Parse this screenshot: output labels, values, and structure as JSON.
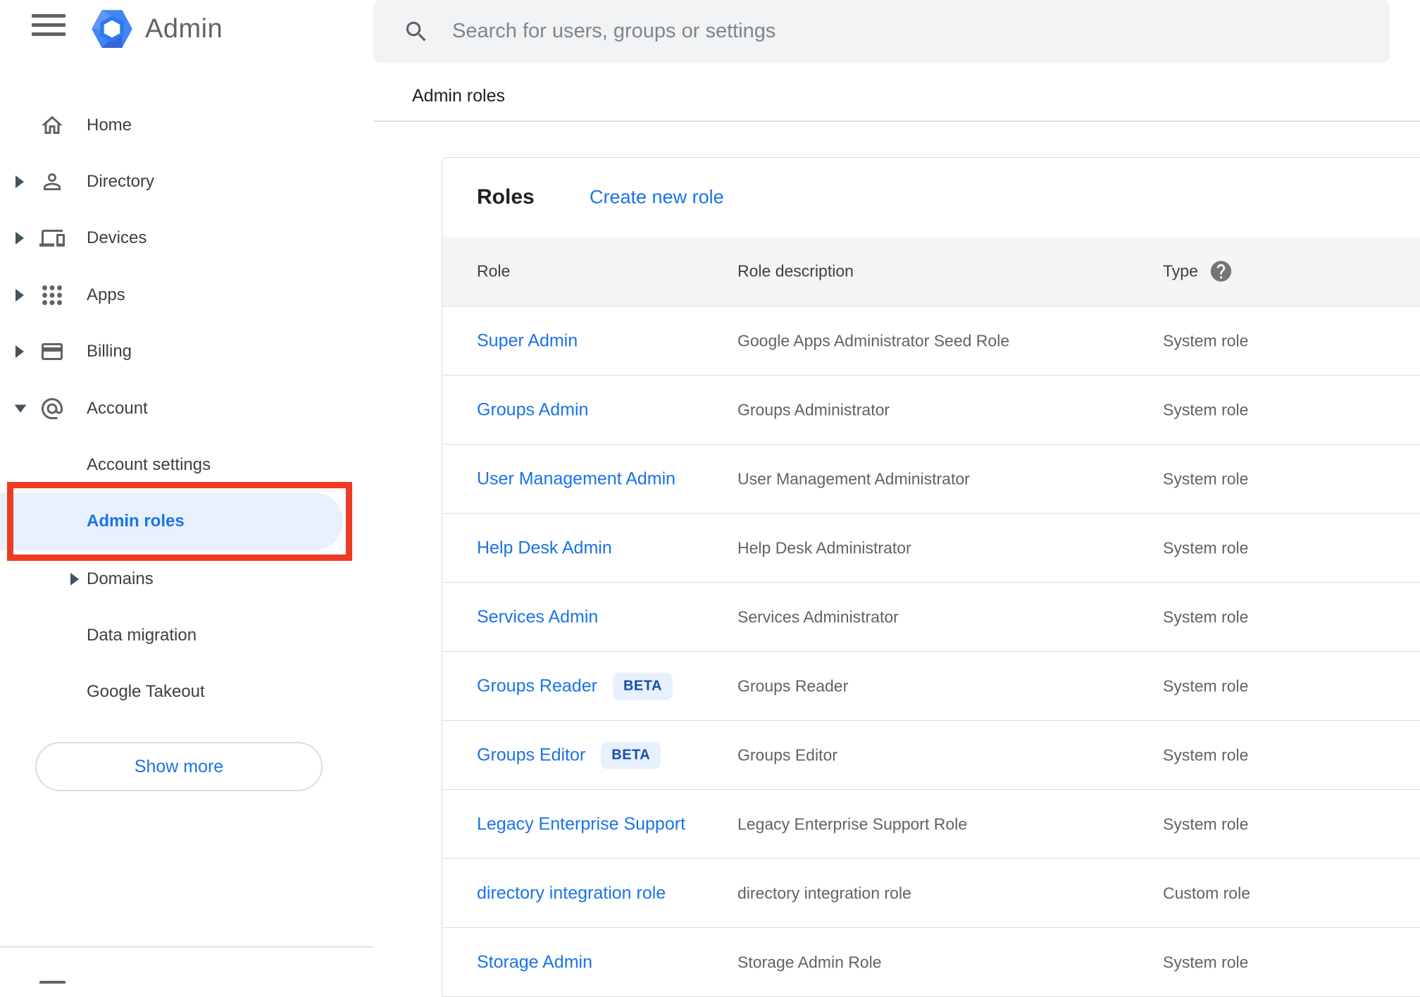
{
  "app": {
    "title": "Admin"
  },
  "search": {
    "placeholder": "Search for users, groups or settings"
  },
  "breadcrumb": "Admin roles",
  "sidebar": {
    "items": [
      {
        "label": "Home"
      },
      {
        "label": "Directory"
      },
      {
        "label": "Devices"
      },
      {
        "label": "Apps"
      },
      {
        "label": "Billing"
      },
      {
        "label": "Account"
      }
    ],
    "account_children": [
      {
        "label": "Account settings"
      },
      {
        "label": "Admin roles",
        "selected": true
      },
      {
        "label": "Domains"
      },
      {
        "label": "Data migration"
      },
      {
        "label": "Google Takeout"
      }
    ],
    "show_more_label": "Show more"
  },
  "card": {
    "title": "Roles",
    "create_link": "Create new role"
  },
  "table": {
    "headers": {
      "role": "Role",
      "description": "Role description",
      "type": "Type"
    },
    "rows": [
      {
        "role": "Super Admin",
        "description": "Google Apps Administrator Seed Role",
        "type": "System role"
      },
      {
        "role": "Groups Admin",
        "description": "Groups Administrator",
        "type": "System role"
      },
      {
        "role": "User Management Admin",
        "description": "User Management Administrator",
        "type": "System role"
      },
      {
        "role": "Help Desk Admin",
        "description": "Help Desk Administrator",
        "type": "System role"
      },
      {
        "role": "Services Admin",
        "description": "Services Administrator",
        "type": "System role"
      },
      {
        "role": "Groups Reader",
        "beta": "BETA",
        "description": "Groups Reader",
        "type": "System role"
      },
      {
        "role": "Groups Editor",
        "beta": "BETA",
        "description": "Groups Editor",
        "type": "System role"
      },
      {
        "role": "Legacy Enterprise Support",
        "description": "Legacy Enterprise Support Role",
        "type": "System role"
      },
      {
        "role": "directory integration role",
        "description": "directory integration role",
        "type": "Custom role"
      },
      {
        "role": "Storage Admin",
        "description": "Storage Admin Role",
        "type": "System role"
      }
    ]
  },
  "colors": {
    "link_blue": "#1A73E8",
    "selected_item_bg": "#E8F0FE",
    "annotation_red": "#EE3B22",
    "beta_badge_bg": "#E8F0FE",
    "beta_badge_text": "#174EA6",
    "logo_blue": "#4285F4",
    "search_bg": "#F1F3F4",
    "table_header_bg": "#F5F5F5"
  }
}
